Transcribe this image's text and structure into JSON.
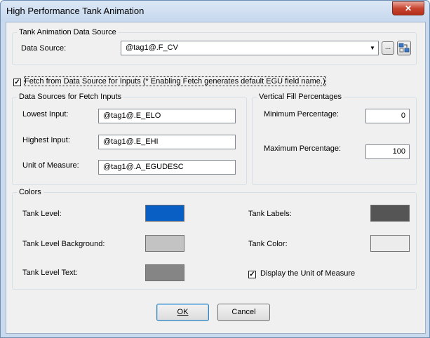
{
  "window": {
    "title": "High Performance Tank Animation",
    "close_glyph": "✕"
  },
  "data_source_group": {
    "title": "Tank Animation Data Source",
    "label": "Data Source:",
    "value": "@tag1@.F_CV",
    "browse_label": "...",
    "dropdown_glyph": "▼",
    "expression_icon": "expression-builder-icon"
  },
  "fetch": {
    "checked": true,
    "check_glyph": "✓",
    "label": "Fetch from Data Source for Inputs (* Enabling Fetch generates default EGU field name.)"
  },
  "fetch_inputs": {
    "title": "Data Sources for Fetch Inputs",
    "fields": [
      {
        "label": "Lowest Input:",
        "value": "@tag1@.E_ELO"
      },
      {
        "label": "Highest Input:",
        "value": "@tag1@.E_EHI"
      },
      {
        "label": "Unit of Measure:",
        "value": "@tag1@.A_EGUDESC"
      }
    ]
  },
  "fill_percentages": {
    "title": "Vertical Fill Percentages",
    "min_label": "Minimum Percentage:",
    "min_value": "0",
    "max_label": "Maximum Percentage:",
    "max_value": "100"
  },
  "colors": {
    "title": "Colors",
    "tank_level": {
      "label": "Tank Level:",
      "color": "#0a5fc4"
    },
    "tank_level_background": {
      "label": "Tank Level Background:",
      "color": "#c3c3c3"
    },
    "tank_level_text": {
      "label": "Tank Level Text:",
      "color": "#858585"
    },
    "tank_labels": {
      "label": "Tank Labels:",
      "color": "#555555"
    },
    "tank_color": {
      "label": "Tank Color:",
      "color": "#ececec"
    },
    "display_uom": {
      "checked": true,
      "label": "Display the Unit of Measure"
    }
  },
  "buttons": {
    "ok": "OK",
    "cancel": "Cancel"
  }
}
